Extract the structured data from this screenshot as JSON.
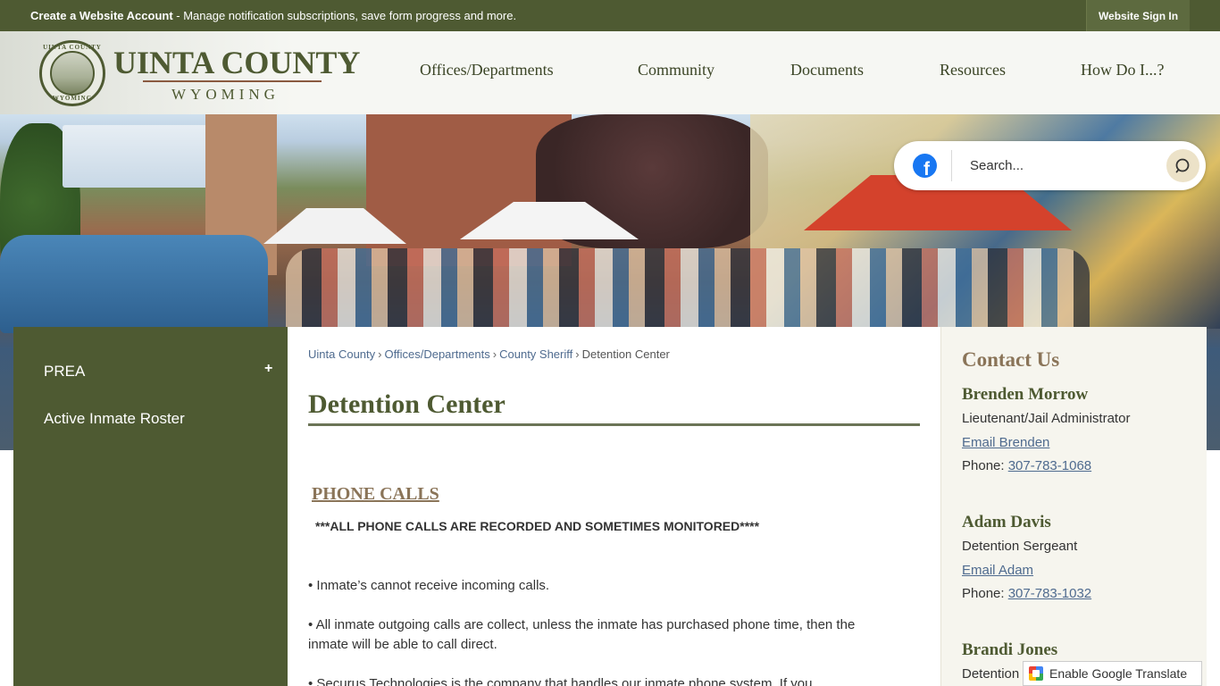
{
  "topbar": {
    "create_bold": "Create a Website Account",
    "create_rest": " - Manage notification subscriptions, save form progress and more.",
    "signin_label": "Website Sign In"
  },
  "logo": {
    "title": "UINTA COUNTY",
    "subtitle": "WYOMING",
    "seal_top": "UINTA COUNTY",
    "seal_bottom": "WYOMING"
  },
  "nav": {
    "items": [
      "Offices/Departments",
      "Community",
      "Documents",
      "Resources",
      "How Do I...?"
    ]
  },
  "search": {
    "placeholder": "Search...",
    "facebook_glyph": "f"
  },
  "sidebar": {
    "items": [
      {
        "label": "PREA",
        "expand": "+"
      },
      {
        "label": "Active Inmate Roster"
      }
    ]
  },
  "breadcrumb": {
    "items": [
      "Uinta County",
      "Offices/Departments",
      "County Sheriff"
    ],
    "current": "Detention Center",
    "separator": "›"
  },
  "main": {
    "title": "Detention Center",
    "section_heading": "PHONE CALLS",
    "warning": "***ALL PHONE CALLS ARE RECORDED AND SOMETIMES MONITORED****",
    "paragraphs": [
      "• Inmate’s cannot receive incoming calls.",
      "• All inmate outgoing calls are collect, unless the inmate has purchased phone time, then the                 inmate will be able to call direct.",
      "• Securus Technologies is the company that handles our inmate phone system. If you"
    ]
  },
  "contact": {
    "heading": "Contact Us",
    "people": [
      {
        "name": "Brenden Morrow",
        "role": "Lieutenant/Jail Administrator",
        "email_label": "Email Brenden",
        "phone_prefix": "Phone: ",
        "phone": "307-783-1068"
      },
      {
        "name": "Adam Davis",
        "role": "Detention Sergeant",
        "email_label": "Email Adam",
        "phone_prefix": "Phone: ",
        "phone": "307-783-1032"
      },
      {
        "name": "Brandi Jones",
        "role": "Detention"
      }
    ]
  },
  "translate": {
    "label": "Enable Google Translate"
  },
  "colors": {
    "brand_green": "#4e5a32",
    "accent_tan": "#8a7458",
    "link_blue": "#4f6b8f",
    "facebook_blue": "#1877f2"
  },
  "icons": [
    "facebook-icon",
    "search-icon",
    "plus-icon",
    "google-translate-icon",
    "county-seal-logo"
  ]
}
